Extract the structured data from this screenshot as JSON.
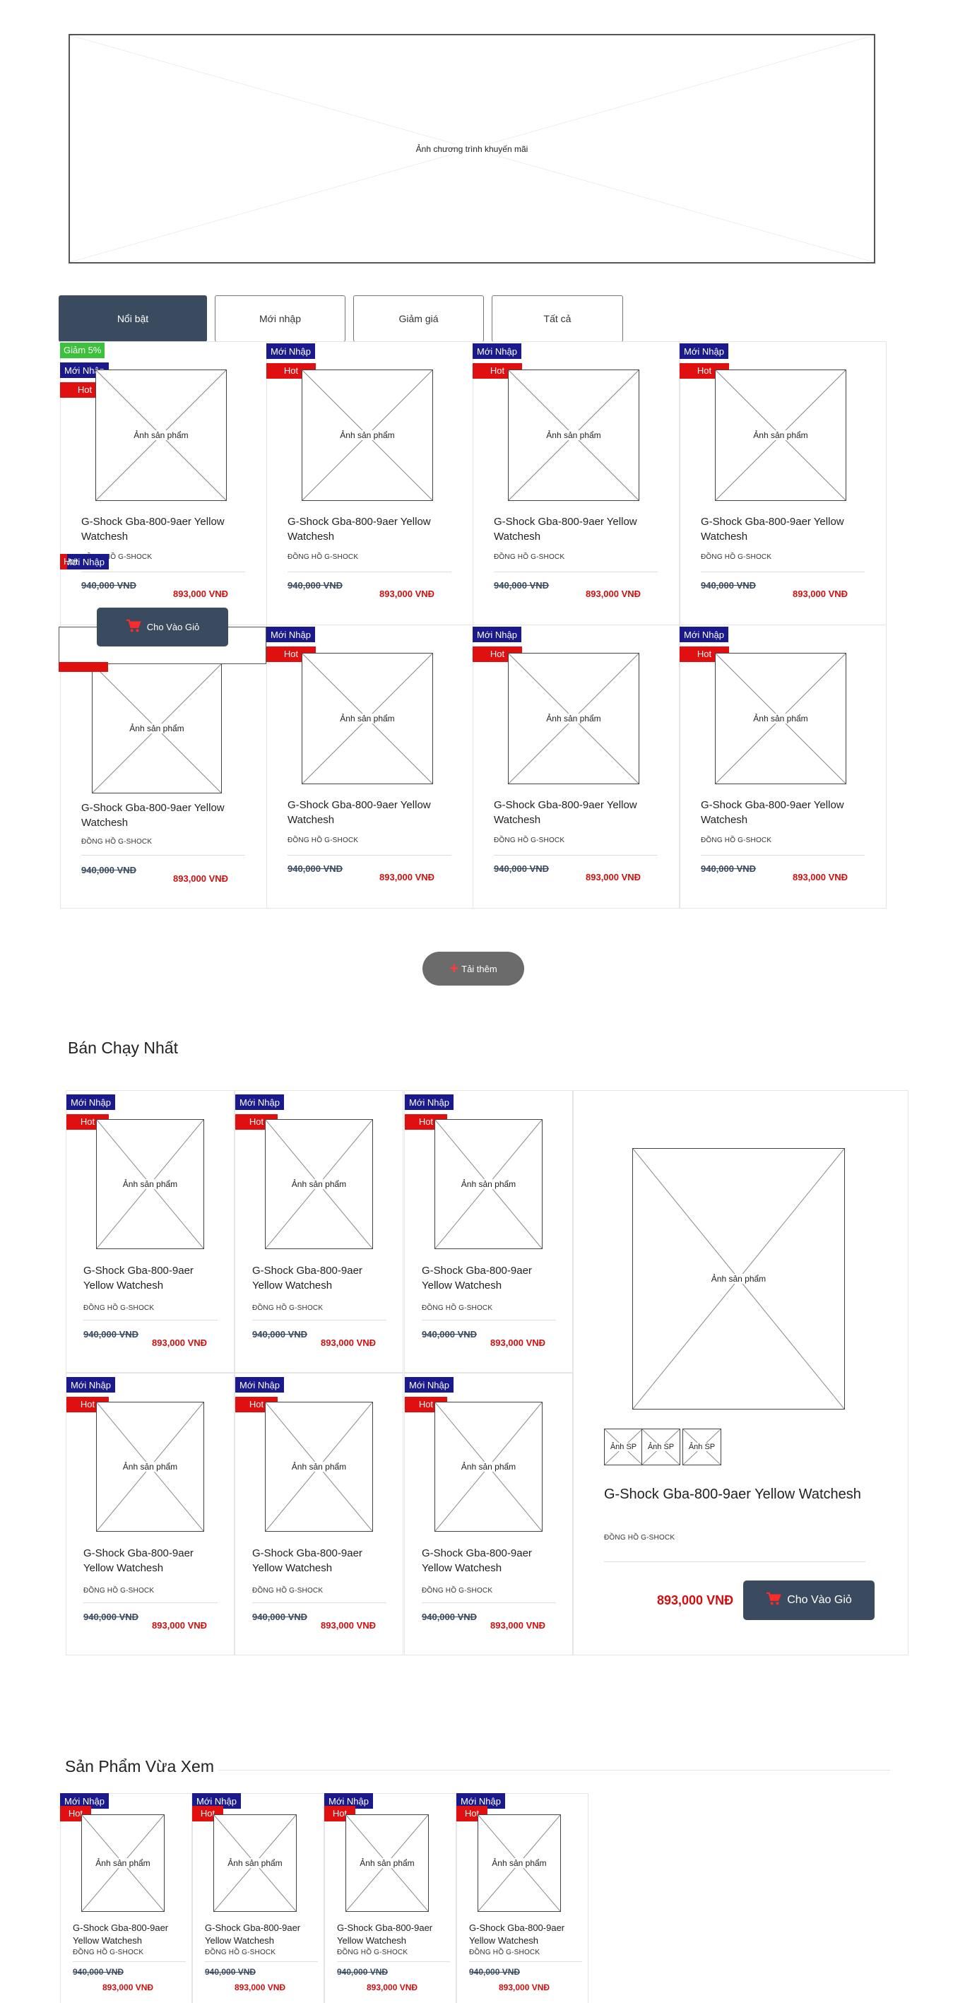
{
  "banner": {
    "label": "Ảnh chương trình khuyến mãi"
  },
  "tabs": [
    {
      "label": "Nổi bật",
      "active": true
    },
    {
      "label": "Mới nhập",
      "active": false
    },
    {
      "label": "Giảm giá",
      "active": false
    },
    {
      "label": "Tất cả",
      "active": false
    }
  ],
  "badges": {
    "sale": "Giảm 5%",
    "new": "Mới Nhập",
    "hot": "Hot"
  },
  "product": {
    "name": "G-Shock Gba-800-9aer Yellow Watchesh",
    "category": "ĐỒNG HỒ G-SHOCK",
    "old_price": "940,000 VNĐ",
    "new_price": "893,000 VNĐ",
    "image_label": "Ảnh sản phẩm"
  },
  "cart_button": {
    "label": "Cho Vào Giỏ",
    "icon": "cart-icon"
  },
  "load_more": {
    "label": "Tải thêm",
    "icon": "plus-icon"
  },
  "bestseller": {
    "title": "Bán Chạy Nhất",
    "featured": {
      "image_label": "Ảnh sản phẩm",
      "thumbs": [
        "Ảnh SP",
        "Ảnh SP",
        "Ảnh SP"
      ],
      "name": "G-Shock Gba-800-9aer Yellow Watchesh",
      "category": "ĐỒNG HỒ G-SHOCK",
      "price": "893,000 VNĐ",
      "button": "Cho Vào Giỏ"
    }
  },
  "recent": {
    "title": "Sản Phẩm Vừa Xem"
  },
  "colors": {
    "accent": "#3a4a5f",
    "hot": "#e01010",
    "new": "#1a1a8c",
    "sale": "#3cc13c",
    "price": "#d01010"
  }
}
